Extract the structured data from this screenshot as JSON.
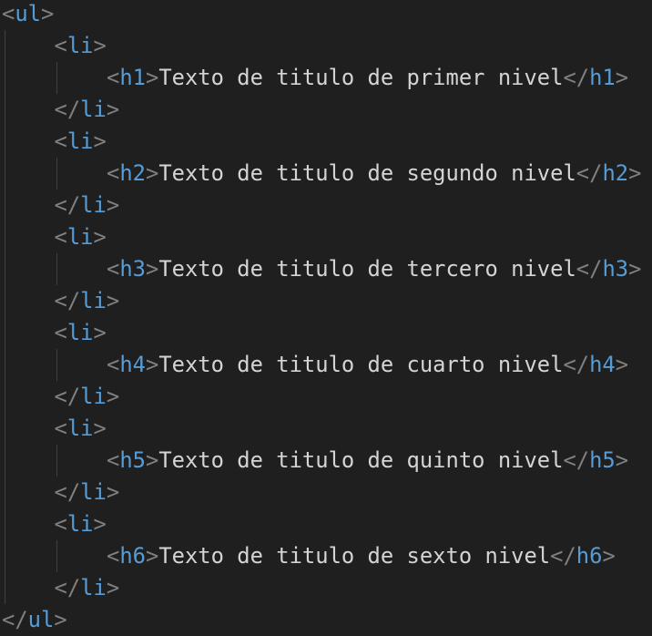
{
  "code": {
    "outer_tag": "ul",
    "item_tag": "li",
    "items": [
      {
        "tag": "h1",
        "text": "Texto de titulo de primer nivel"
      },
      {
        "tag": "h2",
        "text": "Texto de titulo de segundo nivel"
      },
      {
        "tag": "h3",
        "text": "Texto de titulo de tercero nivel"
      },
      {
        "tag": "h4",
        "text": "Texto de titulo de cuarto nivel"
      },
      {
        "tag": "h5",
        "text": "Texto de titulo de quinto nivel"
      },
      {
        "tag": "h6",
        "text": "Texto de titulo de sexto nivel"
      }
    ]
  },
  "colors": {
    "background": "#1f1f1f",
    "bracket": "#808080",
    "tag_name": "#569cd6",
    "text": "#d4d4d4",
    "indent_guide": "#404040"
  }
}
